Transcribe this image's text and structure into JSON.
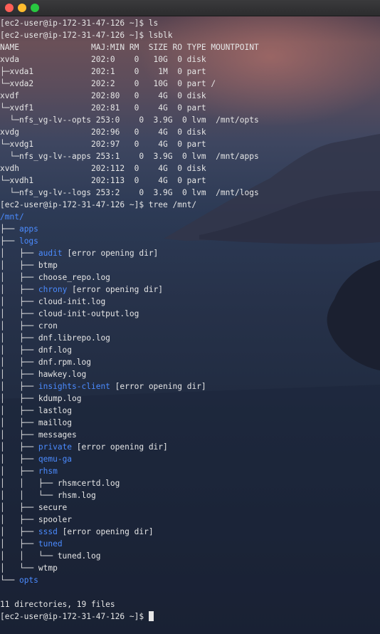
{
  "window": {
    "lights": [
      "close",
      "minimize",
      "zoom"
    ]
  },
  "colors": {
    "directory": "#4b8bff",
    "text": "#e6e6e6"
  },
  "terminal": {
    "lines": [
      {
        "segments": [
          {
            "text": "[ec2-user@ip-172-31-47-126 ~]$ ls"
          }
        ]
      },
      {
        "segments": [
          {
            "text": "[ec2-user@ip-172-31-47-126 ~]$ lsblk"
          }
        ]
      },
      {
        "segments": [
          {
            "text": "NAME               MAJ:MIN RM  SIZE RO TYPE MOUNTPOINT"
          }
        ]
      },
      {
        "segments": [
          {
            "text": "xvda               202:0    0   10G  0 disk"
          }
        ]
      },
      {
        "segments": [
          {
            "text": "├─xvda1            202:1    0    1M  0 part"
          }
        ]
      },
      {
        "segments": [
          {
            "text": "└─xvda2            202:2    0   10G  0 part /"
          }
        ]
      },
      {
        "segments": [
          {
            "text": "xvdf               202:80   0    4G  0 disk"
          }
        ]
      },
      {
        "segments": [
          {
            "text": "└─xvdf1            202:81   0    4G  0 part"
          }
        ]
      },
      {
        "segments": [
          {
            "text": "  └─nfs_vg-lv--opts 253:0    0  3.9G  0 lvm  /mnt/opts"
          }
        ]
      },
      {
        "segments": [
          {
            "text": "xvdg               202:96   0    4G  0 disk"
          }
        ]
      },
      {
        "segments": [
          {
            "text": "└─xvdg1            202:97   0    4G  0 part"
          }
        ]
      },
      {
        "segments": [
          {
            "text": "  └─nfs_vg-lv--apps 253:1    0  3.9G  0 lvm  /mnt/apps"
          }
        ]
      },
      {
        "segments": [
          {
            "text": "xvdh               202:112  0    4G  0 disk"
          }
        ]
      },
      {
        "segments": [
          {
            "text": "└─xvdh1            202:113  0    4G  0 part"
          }
        ]
      },
      {
        "segments": [
          {
            "text": "  └─nfs_vg-lv--logs 253:2    0  3.9G  0 lvm  /mnt/logs"
          }
        ]
      },
      {
        "segments": [
          {
            "text": "[ec2-user@ip-172-31-47-126 ~]$ tree /mnt/"
          }
        ]
      },
      {
        "segments": [
          {
            "text": "/mnt/",
            "color": "blue"
          }
        ]
      },
      {
        "segments": [
          {
            "text": "├── "
          },
          {
            "text": "apps",
            "color": "blue"
          }
        ]
      },
      {
        "segments": [
          {
            "text": "├── "
          },
          {
            "text": "logs",
            "color": "blue"
          }
        ]
      },
      {
        "segments": [
          {
            "text": "│   ├── "
          },
          {
            "text": "audit",
            "color": "blue"
          },
          {
            "text": " [error opening dir]"
          }
        ]
      },
      {
        "segments": [
          {
            "text": "│   ├── btmp"
          }
        ]
      },
      {
        "segments": [
          {
            "text": "│   ├── choose_repo.log"
          }
        ]
      },
      {
        "segments": [
          {
            "text": "│   ├── "
          },
          {
            "text": "chrony",
            "color": "blue"
          },
          {
            "text": " [error opening dir]"
          }
        ]
      },
      {
        "segments": [
          {
            "text": "│   ├── cloud-init.log"
          }
        ]
      },
      {
        "segments": [
          {
            "text": "│   ├── cloud-init-output.log"
          }
        ]
      },
      {
        "segments": [
          {
            "text": "│   ├── cron"
          }
        ]
      },
      {
        "segments": [
          {
            "text": "│   ├── dnf.librepo.log"
          }
        ]
      },
      {
        "segments": [
          {
            "text": "│   ├── dnf.log"
          }
        ]
      },
      {
        "segments": [
          {
            "text": "│   ├── dnf.rpm.log"
          }
        ]
      },
      {
        "segments": [
          {
            "text": "│   ├── hawkey.log"
          }
        ]
      },
      {
        "segments": [
          {
            "text": "│   ├── "
          },
          {
            "text": "insights-client",
            "color": "blue"
          },
          {
            "text": " [error opening dir]"
          }
        ]
      },
      {
        "segments": [
          {
            "text": "│   ├── kdump.log"
          }
        ]
      },
      {
        "segments": [
          {
            "text": "│   ├── lastlog"
          }
        ]
      },
      {
        "segments": [
          {
            "text": "│   ├── maillog"
          }
        ]
      },
      {
        "segments": [
          {
            "text": "│   ├── messages"
          }
        ]
      },
      {
        "segments": [
          {
            "text": "│   ├── "
          },
          {
            "text": "private",
            "color": "blue"
          },
          {
            "text": " [error opening dir]"
          }
        ]
      },
      {
        "segments": [
          {
            "text": "│   ├── "
          },
          {
            "text": "qemu-ga",
            "color": "blue"
          }
        ]
      },
      {
        "segments": [
          {
            "text": "│   ├── "
          },
          {
            "text": "rhsm",
            "color": "blue"
          }
        ]
      },
      {
        "segments": [
          {
            "text": "│   │   ├── rhsmcertd.log"
          }
        ]
      },
      {
        "segments": [
          {
            "text": "│   │   └── rhsm.log"
          }
        ]
      },
      {
        "segments": [
          {
            "text": "│   ├── secure"
          }
        ]
      },
      {
        "segments": [
          {
            "text": "│   ├── spooler"
          }
        ]
      },
      {
        "segments": [
          {
            "text": "│   ├── "
          },
          {
            "text": "sssd",
            "color": "blue"
          },
          {
            "text": " [error opening dir]"
          }
        ]
      },
      {
        "segments": [
          {
            "text": "│   ├── "
          },
          {
            "text": "tuned",
            "color": "blue"
          }
        ]
      },
      {
        "segments": [
          {
            "text": "│   │   └── tuned.log"
          }
        ]
      },
      {
        "segments": [
          {
            "text": "│   └── wtmp"
          }
        ]
      },
      {
        "segments": [
          {
            "text": "└── "
          },
          {
            "text": "opts",
            "color": "blue"
          }
        ]
      },
      {
        "segments": [
          {
            "text": ""
          }
        ]
      },
      {
        "segments": [
          {
            "text": "11 directories, 19 files"
          }
        ]
      },
      {
        "segments": [
          {
            "text": "[ec2-user@ip-172-31-47-126 ~]$ "
          }
        ],
        "cursor": true
      }
    ]
  }
}
